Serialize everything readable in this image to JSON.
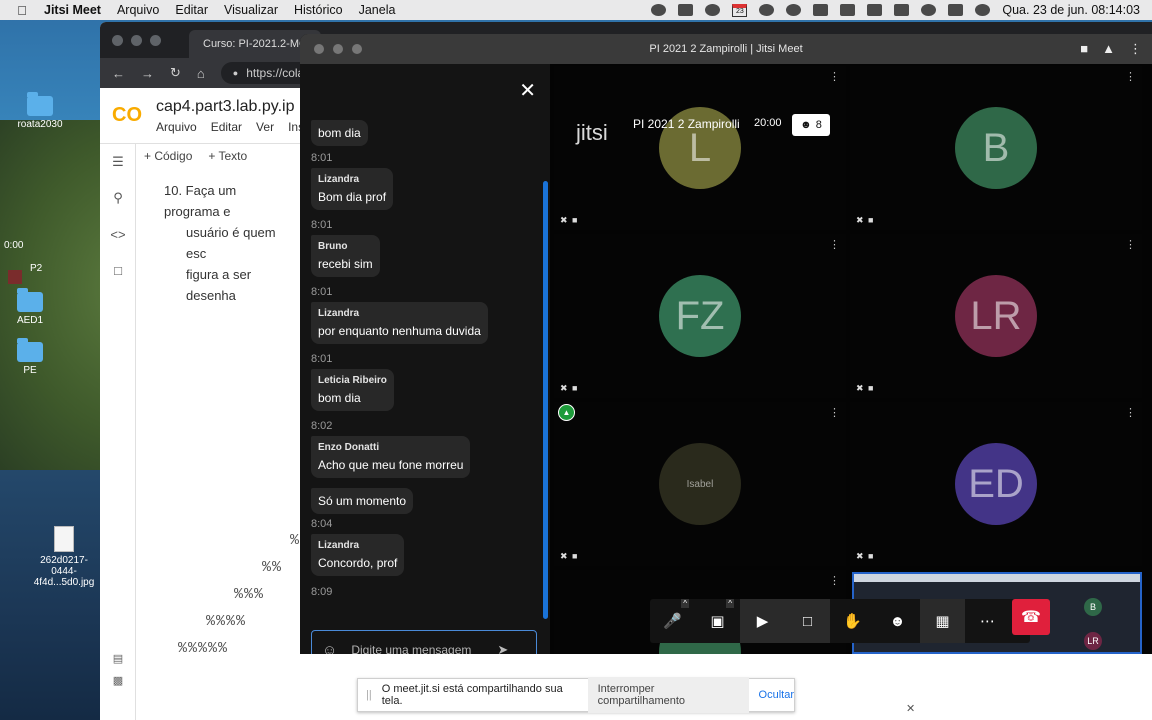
{
  "menubar": {
    "app_name": "Jitsi Meet",
    "items": [
      "Arquivo",
      "Editar",
      "Visualizar",
      "Histórico",
      "Janela"
    ],
    "calendar_day": "23",
    "datetime": "Qua. 23 de jun.  08:14:03"
  },
  "desktop": {
    "icons": [
      {
        "label": "roata2030",
        "type": "folder"
      },
      {
        "label": "AED1",
        "type": "folder"
      },
      {
        "label": "PE",
        "type": "folder"
      },
      {
        "label": "262d0217-0444-4f4d...5d0.jpg",
        "type": "file"
      }
    ],
    "stray_time": "0:00",
    "stray_label": "P2"
  },
  "browser": {
    "tab_title": "Curso: PI-2021.2-MC",
    "url": "https://cola",
    "colab": {
      "logo": "CO",
      "doc_title": "cap4.part3.lab.py.ip",
      "menu": [
        "Arquivo",
        "Editar",
        "Ver",
        "Inser"
      ],
      "toolbar": [
        "+ Código",
        "+ Texto"
      ],
      "exercise_line1": "10. Faça um programa e",
      "exercise_line2": "usuário é quem esc",
      "exercise_line3": "figura a ser desenha",
      "pattern_rows": [
        "%",
        "%%",
        "%%%",
        "%%%%",
        "%%%%%"
      ]
    },
    "share_bar": {
      "message": "O meet.jit.si está compartilhando sua tela.",
      "stop_button": "Interromper compartilhamento",
      "hide_link": "Ocultar"
    }
  },
  "jitsi": {
    "window_title": "PI 2021 2 Zampirolli | Jitsi Meet",
    "watermark": "jitsi",
    "conference_name": "PI 2021 2 Zampirolli",
    "timer": "20:00",
    "participant_count": "8",
    "chat": {
      "placeholder": "Digite uma mensagem",
      "entries": [
        {
          "sender": "",
          "text": "bom dia",
          "time": "8:01"
        },
        {
          "sender": "Lizandra",
          "text": "Bom dia prof",
          "time": "8:01"
        },
        {
          "sender": "Bruno",
          "text": "recebi sim",
          "time": "8:01"
        },
        {
          "sender": "Lizandra",
          "text": "por enquanto nenhuma duvida",
          "time": "8:01"
        },
        {
          "sender": "Leticia Ribeiro",
          "text": "bom dia",
          "time": "8:02"
        },
        {
          "sender": "Enzo Donatti",
          "text": "Acho que meu fone morreu",
          "time": ""
        },
        {
          "sender": "",
          "text": "Só um momento",
          "time": "8:04"
        },
        {
          "sender": "Lizandra",
          "text": "Concordo, prof",
          "time": "8:09"
        }
      ]
    },
    "tiles": [
      {
        "initials": "L",
        "color": "#7a7a3a"
      },
      {
        "initials": "B",
        "color": "#3a6a4a"
      },
      {
        "initials": "FZ",
        "color": "#3f7a58"
      },
      {
        "initials": "LR",
        "color": "#7a2c48"
      },
      {
        "initials": "Isabel",
        "color": "#2e2e20"
      },
      {
        "initials": "ED",
        "color": "#4a3a8a"
      }
    ],
    "mini_screen_initials": [
      "B",
      "LR"
    ]
  }
}
